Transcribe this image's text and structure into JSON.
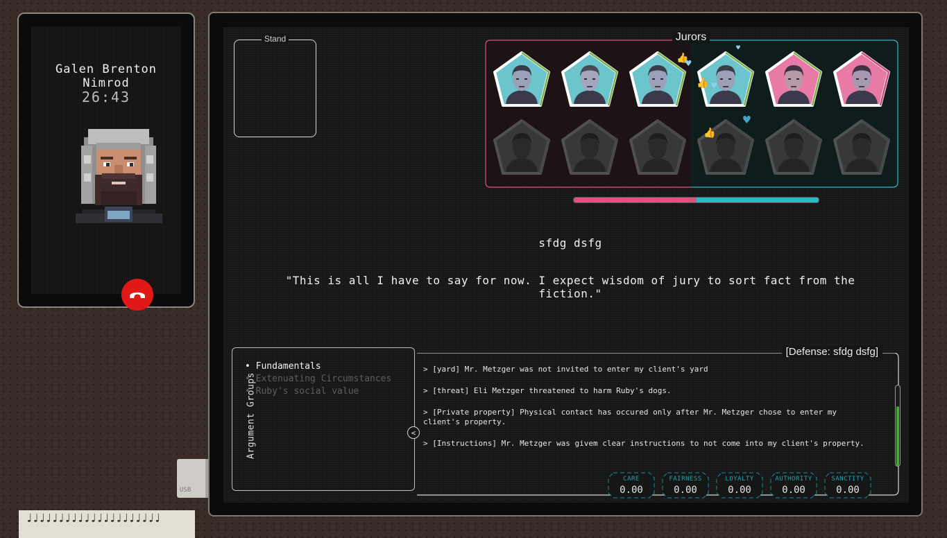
{
  "call": {
    "caller_name": "Galen Brenton Nimrod",
    "timer": "26:43",
    "portrait": "judge-portrait",
    "hangup_icon": "phone-hangup-icon"
  },
  "stand": {
    "label": "Stand"
  },
  "jurors": {
    "title": "Jurors",
    "left_color": "#e2507f",
    "right_color": "#28bcc4",
    "row1": [
      {
        "bg": "#6cc4cc",
        "hair": "#39394a",
        "skin": "#9aa0b8",
        "ring": "#7bb04a"
      },
      {
        "bg": "#6cc4cc",
        "hair": "#4a4a55",
        "skin": "#a3a6bd",
        "ring": "#7bb04a"
      },
      {
        "bg": "#6cc4cc",
        "hair": "#3c3c48",
        "skin": "#9aa0b8",
        "ring": "#7bb04a"
      },
      {
        "bg": "#6cc4cc",
        "hair": "#3c3c48",
        "skin": "#9aa0b8",
        "ring": "#7bb04a"
      },
      {
        "bg": "#e87aa6",
        "hair": "#3e3442",
        "skin": "#b79aa8",
        "ring": "#7bb04a"
      },
      {
        "bg": "#e87aa6",
        "hair": "#3e3442",
        "skin": "#a698b0",
        "ring": "#d24a7a"
      }
    ],
    "row2_count": 6,
    "balance": {
      "pink": 0.5,
      "teal": 0.5
    }
  },
  "dialogue": {
    "speaker": "sfdg dsfg",
    "line": "\"This is all I have to say for now. I expect wisdom of jury to sort fact from the fiction.\""
  },
  "argument_groups": {
    "title": "Argument Groups",
    "items": [
      "Fundamentals",
      "Extenuating Circumstances",
      "Ruby's social value"
    ],
    "active": 0,
    "collapse_icon": "chevron-left-icon",
    "collapse_glyph": "<"
  },
  "arguments": {
    "title": "[Defense: sfdg dsfg]",
    "items": [
      "> [yard] Mr. Metzger was not invited to enter my client's yard",
      "> [threat] Eli Metzger threatened to harm Ruby's dogs.",
      "> [Private property] Physical contact has occured only after Mr. Metzger chose to enter my client's property.",
      "> [Instructions] Mr. Metzger was givem clear instructions to not come into my client's property."
    ],
    "scroll_fraction": 0.75
  },
  "morals": [
    {
      "label": "CARE",
      "value": "0.00"
    },
    {
      "label": "FAIRNESS",
      "value": "0.00"
    },
    {
      "label": "LOYALTY",
      "value": "0.00"
    },
    {
      "label": "AUTHORITY",
      "value": "0.00"
    },
    {
      "label": "SANCTITY",
      "value": "0.00"
    }
  ],
  "desk": {
    "usb_label": "USB",
    "notepad_rings": "♩♩♩♩♩♩♩♩♩♩♩♩♩♩♩♩♩♩♩♩♩"
  }
}
